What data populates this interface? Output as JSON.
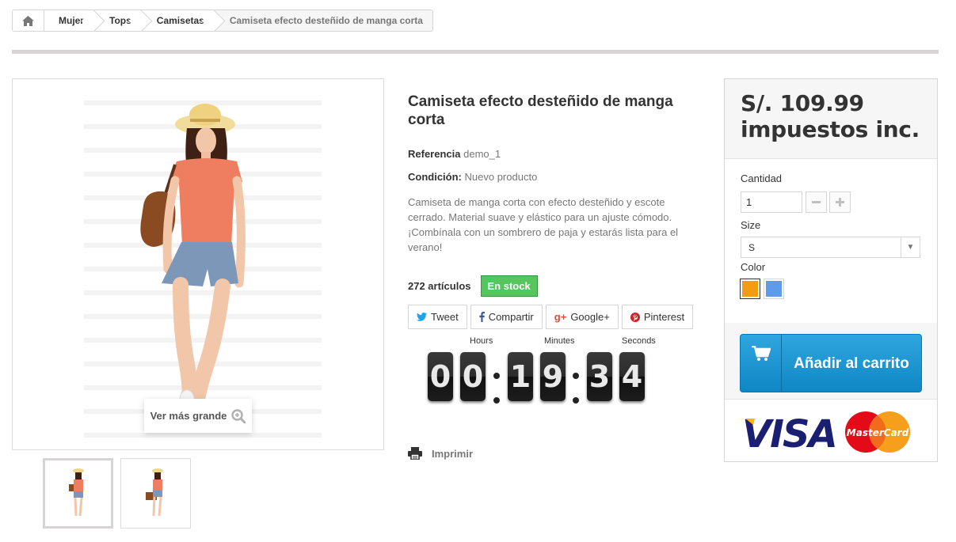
{
  "breadcrumb": {
    "home_icon": "home-icon",
    "items": [
      "Mujer",
      "Tops",
      "Camisetas"
    ],
    "current": "Camiseta efecto desteñido de manga corta"
  },
  "gallery": {
    "zoom_label": "Ver más grande",
    "zoom_icon": "zoom-in-icon",
    "thumbnails": 2,
    "active_thumbnail": 1
  },
  "product": {
    "title": "Camiseta efecto desteñido de manga corta",
    "reference_label": "Referencia",
    "reference_value": "demo_1",
    "condition_label": "Condición:",
    "condition_value": "Nuevo producto",
    "description": "Camiseta de manga corta con efecto desteñido y escote cerrado. Material suave y elástico para un ajuste cómodo. ¡Combínala con un sombrero de paja y estarás lista para el verano!",
    "quantity_text": "272 artículos",
    "stock_badge": "En stock",
    "stock_color": "#55c65e"
  },
  "social": [
    {
      "label": "Tweet",
      "icon": "twitter-icon",
      "color": "#1da1f2"
    },
    {
      "label": "Compartir",
      "icon": "facebook-icon",
      "color": "#3b5998"
    },
    {
      "label": "Google+",
      "icon": "google-plus-icon",
      "color": "#dd4b39"
    },
    {
      "label": "Pinterest",
      "icon": "pinterest-icon",
      "color": "#cb2027"
    }
  ],
  "countdown": {
    "hours_label": "Hours",
    "minutes_label": "Minutes",
    "seconds_label": "Seconds",
    "digits": [
      "0",
      "0",
      "1",
      "9",
      "3",
      "4"
    ]
  },
  "print_label": "Imprimir",
  "buy": {
    "price": "S/. 109.99",
    "tax_note": "impuestos inc.",
    "quantity_label": "Cantidad",
    "quantity_value": "1",
    "size_label": "Size",
    "size_value": "S",
    "color_label": "Color",
    "colors": [
      "#f39c11",
      "#5d9cec"
    ],
    "add_to_cart": "Añadir al carrito",
    "cart_color": "#2fa6df",
    "cards": [
      "VISA",
      "MasterCard"
    ]
  }
}
